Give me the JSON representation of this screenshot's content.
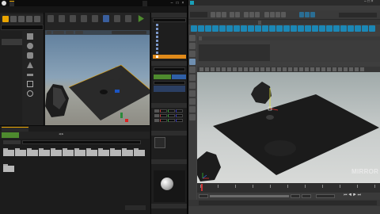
{
  "ue": {
    "menu": [
      "",
      "",
      "",
      ""
    ],
    "tab_level": "",
    "tab_project": "",
    "modes_title": "",
    "mode_categories": [
      "",
      "",
      "",
      "",
      "",
      "",
      "",
      ""
    ],
    "toolbar_buttons": [
      "",
      "",
      "",
      "",
      "",
      "",
      "",
      "",
      ""
    ],
    "viewport_chips": [
      "",
      "",
      "",
      ""
    ],
    "viewport_warning": "",
    "outliner_title": "",
    "outliner_rows": [
      "",
      "",
      "",
      "",
      "",
      "",
      "",
      "",
      "",
      ""
    ],
    "outliner_count": "",
    "details_title": "",
    "details_name": "",
    "add_component": "",
    "blueprint": "",
    "transform_label": "",
    "static_mesh_label": "",
    "materials_label": "",
    "physics_label": "",
    "content": {
      "tab": "",
      "add_new": "",
      "import": "",
      "save_all": "",
      "breadcrumb_root": "",
      "breadcrumb_folder": "",
      "filters": "",
      "folders": [
        "",
        "",
        "",
        "",
        "",
        "",
        "",
        "",
        "",
        "",
        "",
        ""
      ],
      "folders_row2": [
        ""
      ],
      "status": "",
      "view_options": ""
    }
  },
  "maya": {
    "title": "",
    "menu": [
      "",
      "",
      "",
      "",
      "",
      "",
      "",
      "",
      "",
      "",
      "",
      "",
      "",
      "",
      "",
      "",
      ""
    ],
    "workspace": "",
    "shelf_tabs": [
      "",
      "",
      "",
      "",
      "",
      "",
      "",
      "",
      "",
      "",
      "",
      ""
    ],
    "graph_menu": "",
    "graph_tabs": [
      "",
      "",
      "",
      "",
      "",
      ""
    ],
    "table_header": [
      "",
      "",
      "",
      ""
    ],
    "table_rows": [
      [
        "",
        "",
        "",
        ""
      ],
      [
        "",
        "",
        "",
        ""
      ],
      [
        "",
        "",
        "",
        ""
      ],
      [
        "",
        "",
        "",
        ""
      ],
      [
        "",
        "",
        "",
        ""
      ]
    ],
    "viewport_menu": [
      "",
      "",
      "",
      "",
      "",
      ""
    ],
    "timeline_ticks": [
      "",
      "",
      "",
      "",
      "",
      "",
      "",
      "",
      "",
      "",
      ""
    ],
    "range_start": "",
    "range_end": "",
    "anim_end": "",
    "fps": "",
    "cmd_label": "",
    "help_text": ""
  },
  "watermark": {
    "top": "",
    "main": "MIRROR"
  },
  "colors": {
    "ue_accent": "#e8a400",
    "ue_green": "#4e8a2e",
    "maya_blue": "#1b87b5",
    "selection_orange": "#e08a1a"
  }
}
